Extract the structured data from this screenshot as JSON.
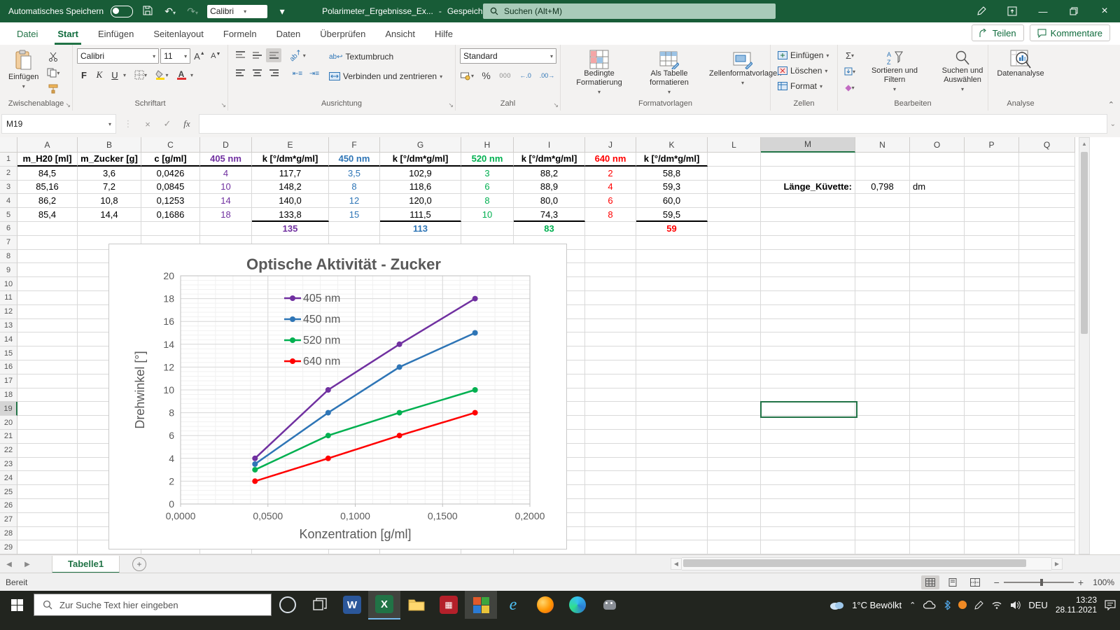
{
  "titlebar": {
    "autosave_label": "Automatisches Speichern",
    "qat_font": "Calibri",
    "doc_title": "Polarimeter_Ergebnisse_Ex...",
    "doc_separator": "-",
    "doc_status": "Gespeichert",
    "search_placeholder": "Suchen (Alt+M)"
  },
  "ribbon": {
    "tabs": [
      "Datei",
      "Start",
      "Einfügen",
      "Seitenlayout",
      "Formeln",
      "Daten",
      "Überprüfen",
      "Ansicht",
      "Hilfe"
    ],
    "active_tab": "Start",
    "share_label": "Teilen",
    "comments_label": "Kommentare",
    "clipboard": {
      "group": "Zwischenablage",
      "paste": "Einfügen"
    },
    "font": {
      "group": "Schriftart",
      "font_name": "Calibri",
      "font_size": "11",
      "bold_label": "F",
      "italic_label": "K",
      "underline_label": "U"
    },
    "alignment": {
      "group": "Ausrichtung",
      "wrap": "Textumbruch",
      "merge": "Verbinden und zentrieren"
    },
    "number": {
      "group": "Zahl",
      "format": "Standard",
      "percent_label": "%",
      "thousands_label": "000",
      "inc_dec_label": "←.0",
      "dec_dec_label": ".00→"
    },
    "styles": {
      "group": "Formatvorlagen",
      "conditional": "Bedingte Formatierung",
      "as_table": "Als Tabelle formatieren",
      "cell_styles": "Zellenformatvorlagen"
    },
    "cells": {
      "group": "Zellen",
      "insert": "Einfügen",
      "delete": "Löschen",
      "format": "Format"
    },
    "editing": {
      "group": "Bearbeiten",
      "sigma": "Σ",
      "sort": "Sortieren und Filtern",
      "find": "Suchen und Auswählen"
    },
    "analysis": {
      "group": "Analyse",
      "data_analysis": "Datenanalyse"
    }
  },
  "formula_bar": {
    "name_box": "M19",
    "fx_label": "fx",
    "formula": ""
  },
  "sheet": {
    "columns": [
      "A",
      "B",
      "C",
      "D",
      "E",
      "F",
      "G",
      "H",
      "I",
      "J",
      "K",
      "L",
      "M",
      "N",
      "O",
      "P",
      "Q"
    ],
    "selected_column": "M",
    "selected_row": 19,
    "visible_rows": 29,
    "table": {
      "headers": [
        {
          "col": "A",
          "text": "m_H20 [ml]",
          "color": "#000000"
        },
        {
          "col": "B",
          "text": "m_Zucker [g]",
          "color": "#000000"
        },
        {
          "col": "C",
          "text": "c [g/ml]",
          "color": "#000000"
        },
        {
          "col": "D",
          "text": "405 nm",
          "color": "#7030A0"
        },
        {
          "col": "E",
          "text": "k [°/dm*g/ml]",
          "color": "#000000"
        },
        {
          "col": "F",
          "text": "450 nm",
          "color": "#2E75B6"
        },
        {
          "col": "G",
          "text": "k [°/dm*g/ml]",
          "color": "#000000"
        },
        {
          "col": "H",
          "text": "520 nm",
          "color": "#00B050"
        },
        {
          "col": "I",
          "text": "k [°/dm*g/ml]",
          "color": "#000000"
        },
        {
          "col": "J",
          "text": "640 nm",
          "color": "#FF0000"
        },
        {
          "col": "K",
          "text": "k [°/dm*g/ml]",
          "color": "#000000"
        }
      ],
      "column_value_colors": {
        "D": "#7030A0",
        "F": "#2E75B6",
        "H": "#00B050",
        "J": "#FF0000"
      },
      "rows": [
        [
          "84,5",
          "3,6",
          "0,0426",
          "4",
          "117,7",
          "3,5",
          "102,9",
          "3",
          "88,2",
          "2",
          "58,8"
        ],
        [
          "85,16",
          "7,2",
          "0,0845",
          "10",
          "148,2",
          "8",
          "118,6",
          "6",
          "88,9",
          "4",
          "59,3"
        ],
        [
          "86,2",
          "10,8",
          "0,1253",
          "14",
          "140,0",
          "12",
          "120,0",
          "8",
          "80,0",
          "6",
          "60,0"
        ],
        [
          "85,4",
          "14,4",
          "0,1686",
          "18",
          "133,8",
          "15",
          "111,5",
          "10",
          "74,3",
          "8",
          "59,5"
        ]
      ],
      "sums": [
        {
          "col": "E",
          "value": "135",
          "color": "#7030A0"
        },
        {
          "col": "G",
          "value": "113",
          "color": "#2E75B6"
        },
        {
          "col": "I",
          "value": "83",
          "color": "#00B050"
        },
        {
          "col": "K",
          "value": "59",
          "color": "#FF0000"
        }
      ],
      "side": {
        "label": "Länge_Küvette:",
        "value": "0,798",
        "unit": "dm"
      }
    }
  },
  "chart_data": {
    "type": "line",
    "title": "Optische Aktivität - Zucker",
    "xlabel": "Konzentration [g/ml]",
    "ylabel": "Drehwinkel [°]",
    "xlim": [
      0,
      0.2
    ],
    "ylim": [
      0,
      20
    ],
    "x_ticks": [
      "0,0000",
      "0,0500",
      "0,1000",
      "0,1500",
      "0,2000"
    ],
    "x_tick_values": [
      0,
      0.05,
      0.1,
      0.15,
      0.2
    ],
    "y_tick_step": 2,
    "grid": true,
    "legend_position": "inside-top-left",
    "x": [
      0.0426,
      0.0845,
      0.1253,
      0.1686
    ],
    "series": [
      {
        "name": "405 nm",
        "color": "#7030A0",
        "values": [
          4,
          10,
          14,
          18
        ]
      },
      {
        "name": "450 nm",
        "color": "#2E75B6",
        "values": [
          3.5,
          8,
          12,
          15
        ]
      },
      {
        "name": "520 nm",
        "color": "#00B050",
        "values": [
          3,
          6,
          8,
          10
        ]
      },
      {
        "name": "640 nm",
        "color": "#FF0000",
        "values": [
          2,
          4,
          6,
          8
        ]
      }
    ]
  },
  "tabs_bar": {
    "sheet_name": "Tabelle1"
  },
  "status_bar": {
    "ready_label": "Bereit",
    "zoom_label": "100%"
  },
  "taskbar": {
    "search_placeholder": "Zur Suche Text hier eingeben",
    "weather": "1°C Bewölkt",
    "lang": "DEU",
    "time": "13:23",
    "date": "28.11.2021"
  }
}
